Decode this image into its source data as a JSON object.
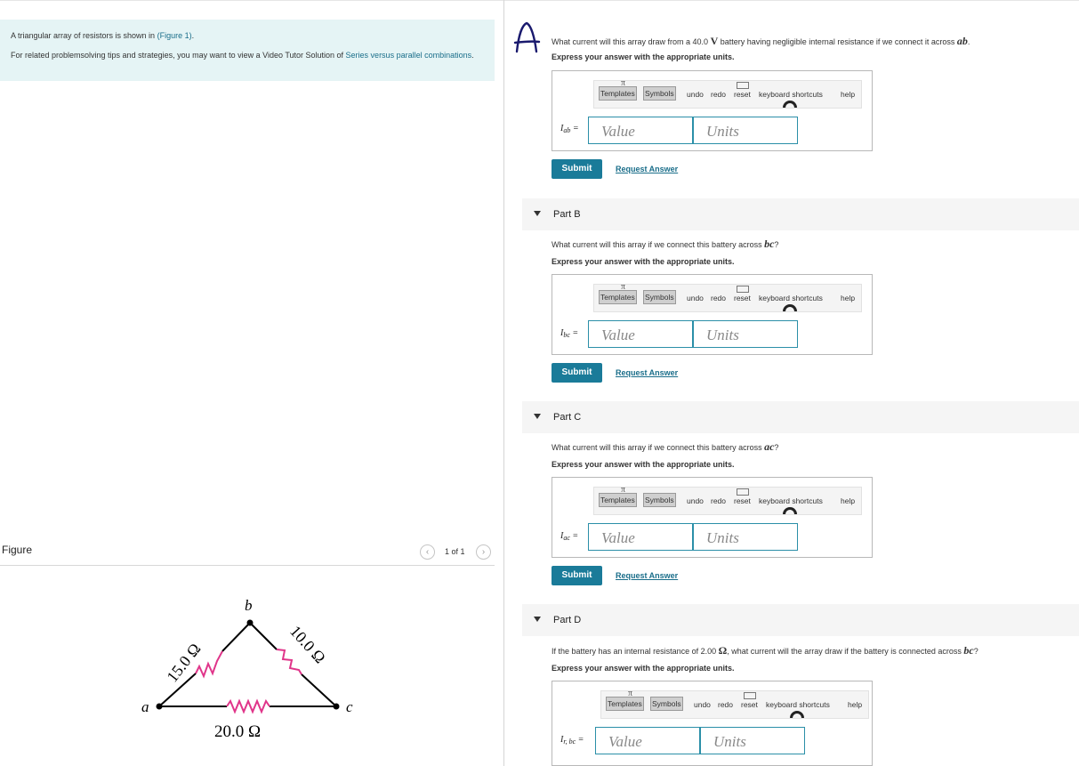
{
  "intro": {
    "line1_prefix": "A triangular array of resistors is shown in ",
    "line1_link": "(Figure 1)",
    "line1_suffix": ".",
    "line2_prefix": "For related problemsolving tips and strategies, you may want to view a Video Tutor Solution of ",
    "line2_link": "Series versus parallel combinations",
    "line2_suffix": "."
  },
  "figure": {
    "title": "Figure",
    "pager": "1 of 1",
    "prev_icon": "chevron-left-icon",
    "next_icon": "chevron-right-icon",
    "node_a": "a",
    "node_b": "b",
    "node_c": "c",
    "r_ab": "15.0 Ω",
    "r_bc": "10.0 Ω",
    "r_ac": "20.0 Ω",
    "resistor_color": "#e0358a"
  },
  "toolbar": {
    "templates": "Templates",
    "symbols": "Symbols",
    "undo": "undo",
    "redo": "redo",
    "reset": "reset",
    "keyboard": "keyboard shortcuts",
    "help": "help",
    "pi": "π"
  },
  "common": {
    "express": "Express your answer with the appropriate units.",
    "value_placeholder": "Value",
    "units_placeholder": "Units",
    "submit": "Submit",
    "request": "Request Answer"
  },
  "parts": [
    {
      "question_prefix": "What current will this array draw from a 40.0 ",
      "question_unit": "V",
      "question_mid": " battery having negligible internal resistance if we connect it across ",
      "question_var": "ab",
      "question_suffix": ".",
      "label_var": "I",
      "label_sub": "ab",
      "equals": "="
    },
    {
      "title": "Part B",
      "question_prefix": "What current will this array if we connect this battery across ",
      "question_var": "bc",
      "question_suffix": "?",
      "label_var": "I",
      "label_sub": "bc",
      "equals": "="
    },
    {
      "title": "Part C",
      "question_prefix": "What current will this array if we connect this battery across ",
      "question_var": "ac",
      "question_suffix": "?",
      "label_var": "I",
      "label_sub": "ac",
      "equals": "="
    },
    {
      "title": "Part D",
      "question_prefix": "If the battery has an internal resistance of 2.00 ",
      "question_unit": "Ω",
      "question_mid": ", what current will the array draw if the battery is connected across ",
      "question_var": "bc",
      "question_suffix": "?",
      "label_var": "I",
      "label_sub": "r, bc",
      "equals": "="
    }
  ]
}
